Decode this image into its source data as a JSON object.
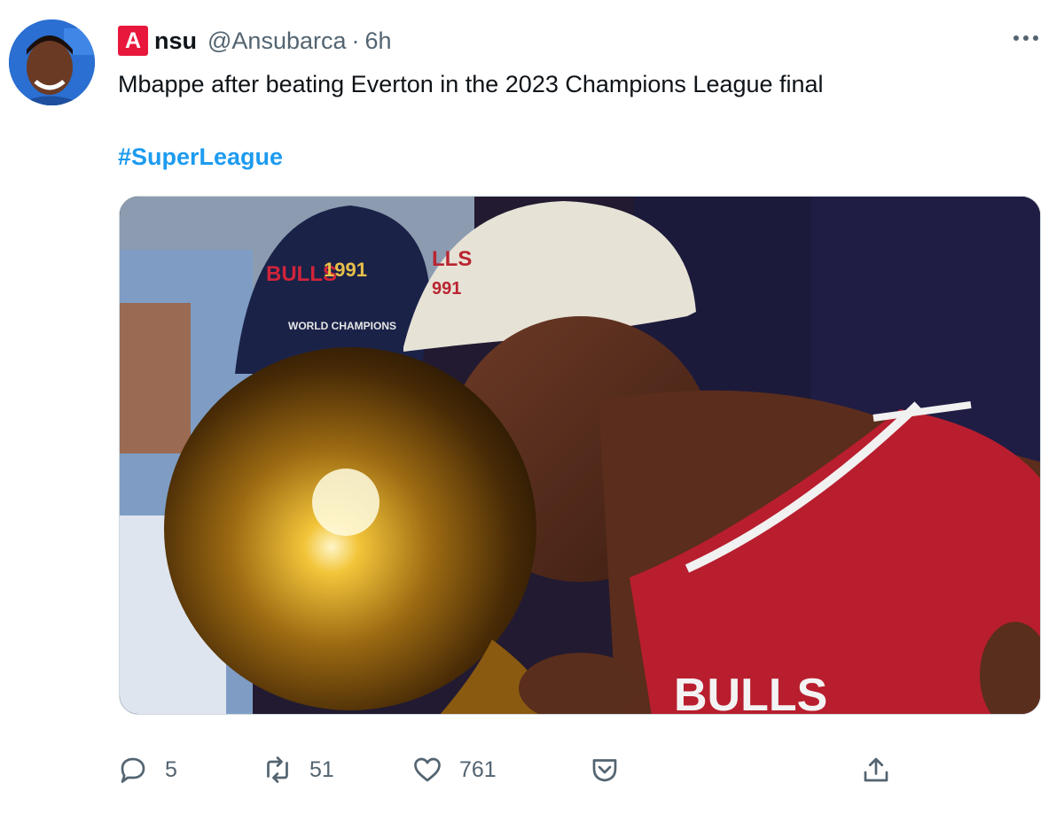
{
  "tweet": {
    "author_badge": "A",
    "author_name_rest": "nsu",
    "handle": "@Ansubarca",
    "separator": "·",
    "time": "6h",
    "text": "Mbappe after beating Everton in the 2023 Champions League final",
    "hashtag": "#SuperLeague",
    "media_texts": {
      "hat_brand": "BULLS",
      "hat_year": "1991",
      "hat_caption": "WORLD CHAMPIONS",
      "white_hat_brand": "LLS",
      "white_hat_year": "991",
      "jersey": "BULLS"
    }
  },
  "actions": {
    "reply_count": "5",
    "retweet_count": "51",
    "like_count": "761"
  },
  "icons": {
    "more": "more-icon",
    "reply": "reply-icon",
    "retweet": "retweet-icon",
    "like": "heart-icon",
    "save": "pocket-icon",
    "share": "share-icon"
  },
  "colors": {
    "link": "#1d9bf0",
    "muted": "#536471",
    "badge": "#e8173c"
  }
}
